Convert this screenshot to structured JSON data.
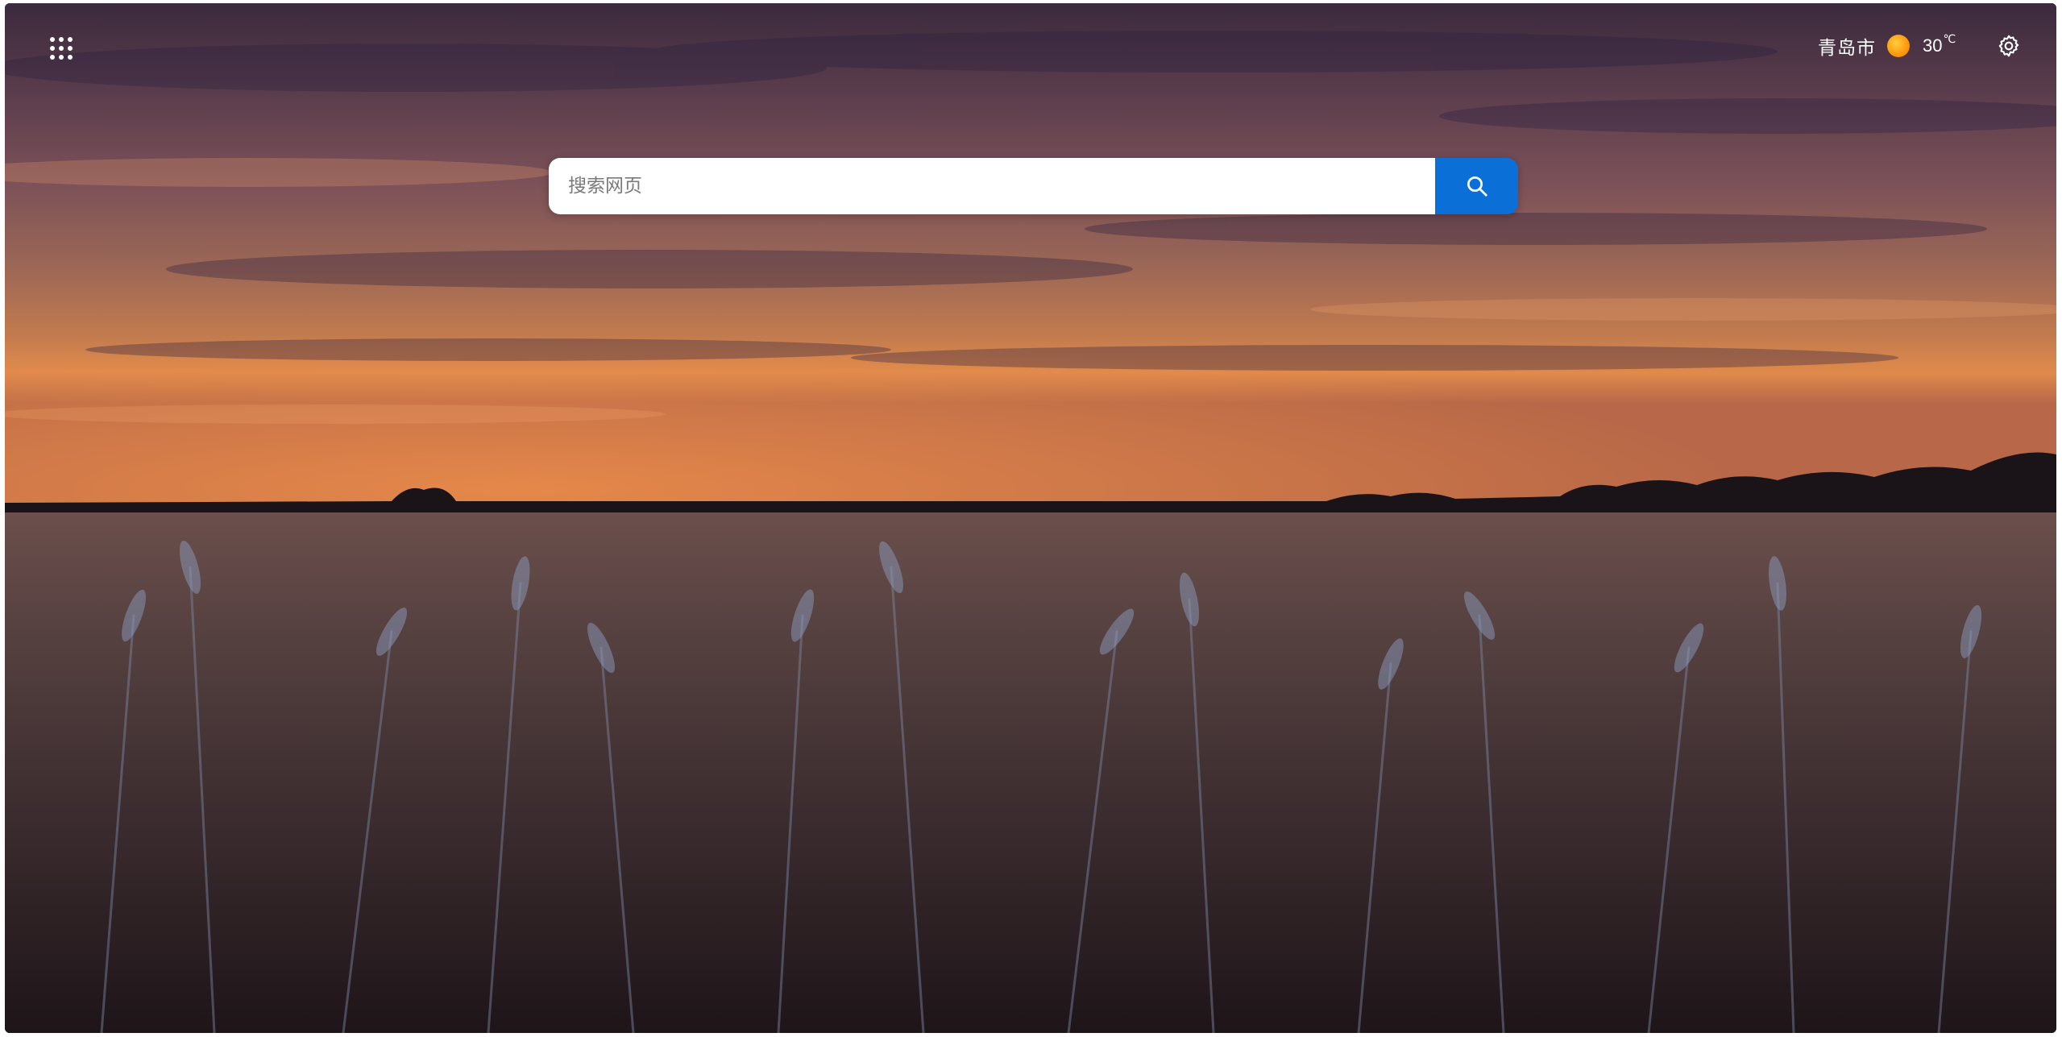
{
  "background": {
    "scene": "wheat-field-sunset",
    "sky_colors": [
      "#3a2a3f",
      "#6a4a5a",
      "#c77a4a",
      "#e0834a"
    ],
    "field_colors": [
      "#4a3a3c",
      "#2a1e22"
    ]
  },
  "header": {
    "apps_icon": "apps-grid-icon",
    "weather": {
      "city": "青岛市",
      "icon": "sun-icon",
      "temperature": "30",
      "unit": "℃"
    },
    "settings_icon": "gear-icon"
  },
  "search": {
    "placeholder": "搜索网页",
    "value": "",
    "button_icon": "search-icon",
    "button_color": "#0a6fd6"
  }
}
